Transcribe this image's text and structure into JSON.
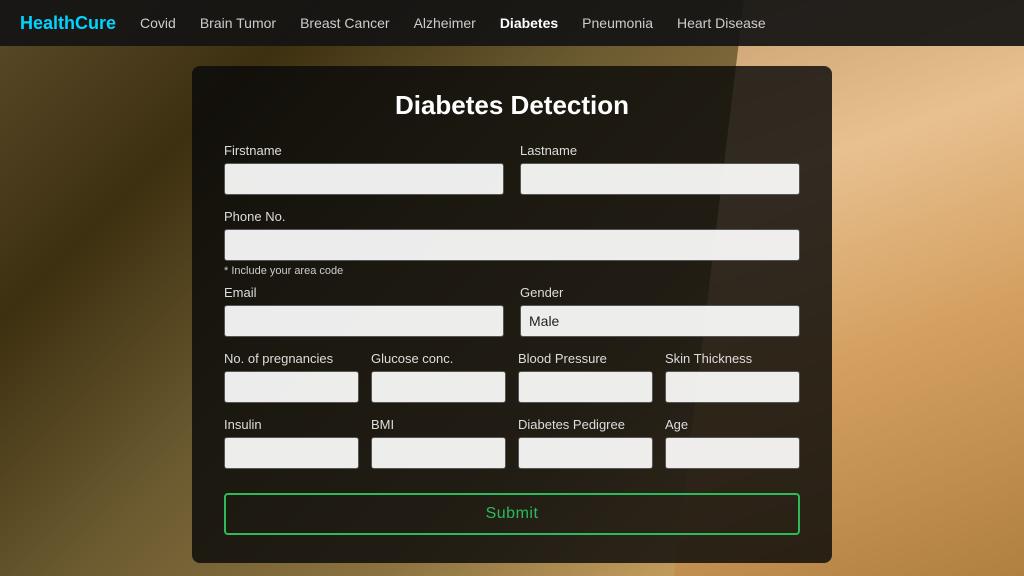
{
  "brand": "HealthCure",
  "nav": {
    "links": [
      {
        "label": "Covid",
        "active": false
      },
      {
        "label": "Brain Tumor",
        "active": false
      },
      {
        "label": "Breast Cancer",
        "active": false
      },
      {
        "label": "Alzheimer",
        "active": false
      },
      {
        "label": "Diabetes",
        "active": true
      },
      {
        "label": "Pneumonia",
        "active": false
      },
      {
        "label": "Heart Disease",
        "active": false
      }
    ]
  },
  "form": {
    "title": "Diabetes Detection",
    "fields": {
      "firstname_label": "Firstname",
      "firstname_placeholder": "",
      "lastname_label": "Lastname",
      "lastname_placeholder": "",
      "phone_label": "Phone No.",
      "phone_placeholder": "",
      "phone_hint": "* Include your area code",
      "email_label": "Email",
      "email_placeholder": "",
      "gender_label": "Gender",
      "gender_value": "Male",
      "pregnancies_label": "No. of pregnancies",
      "glucose_label": "Glucose conc.",
      "bp_label": "Blood Pressure",
      "skin_label": "Skin Thickness",
      "insulin_label": "Insulin",
      "bmi_label": "BMI",
      "pedigree_label": "Diabetes Pedigree",
      "age_label": "Age"
    },
    "submit_label": "Submit"
  }
}
